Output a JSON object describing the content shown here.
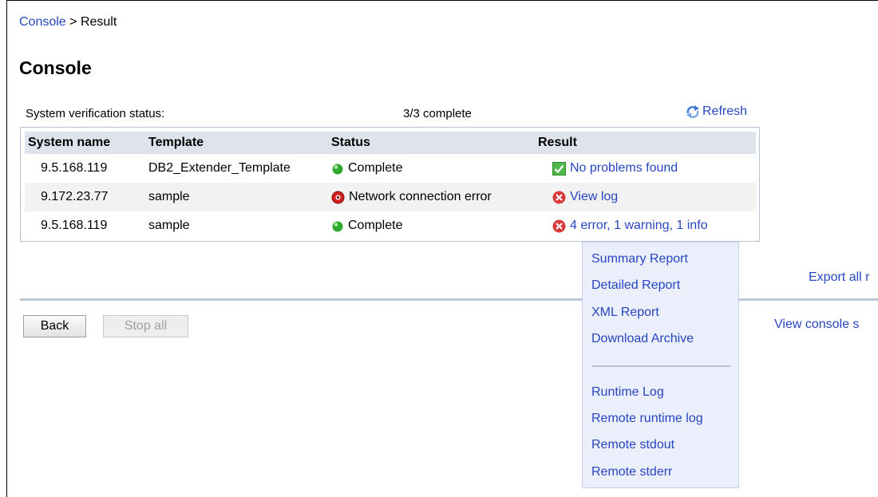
{
  "breadcrumb": {
    "root": "Console",
    "separator": " > ",
    "current": "Result"
  },
  "page_title": "Console",
  "status": {
    "label": "System verification status:",
    "count": "3/3 complete",
    "refresh": "Refresh"
  },
  "table": {
    "headers": [
      "System name",
      "Template",
      "Status",
      "Result"
    ],
    "rows": [
      {
        "system": "9.5.168.119",
        "template": "DB2_Extender_Template",
        "status": "Complete",
        "status_icon": "green-dot-icon",
        "result": "No problems found",
        "result_icon": "check-icon"
      },
      {
        "system": "9.172.23.77",
        "template": "sample",
        "status": "Network connection error",
        "status_icon": "red-alert-icon",
        "result": "View log",
        "result_icon": "error-x-icon"
      },
      {
        "system": "9.5.168.119",
        "template": "sample",
        "status": "Complete",
        "status_icon": "green-dot-icon",
        "result": "4 error, 1 warning, 1 info",
        "result_icon": "error-x-icon"
      }
    ]
  },
  "export_all": "Export all r",
  "buttons": {
    "back": "Back",
    "stop_all": "Stop all"
  },
  "view_console": "View console s",
  "menu": {
    "items": [
      "Summary Report",
      "Detailed Report",
      "XML Report",
      "Download Archive"
    ],
    "items2": [
      "Runtime Log",
      "Remote runtime log",
      "Remote stdout",
      "Remote stderr"
    ]
  },
  "colors": {
    "link": "#2646c0",
    "header_bg": "#dfe4ec",
    "menu_bg": "#ebeefb",
    "ok": "#2fa82f",
    "error": "#d63a3a"
  }
}
